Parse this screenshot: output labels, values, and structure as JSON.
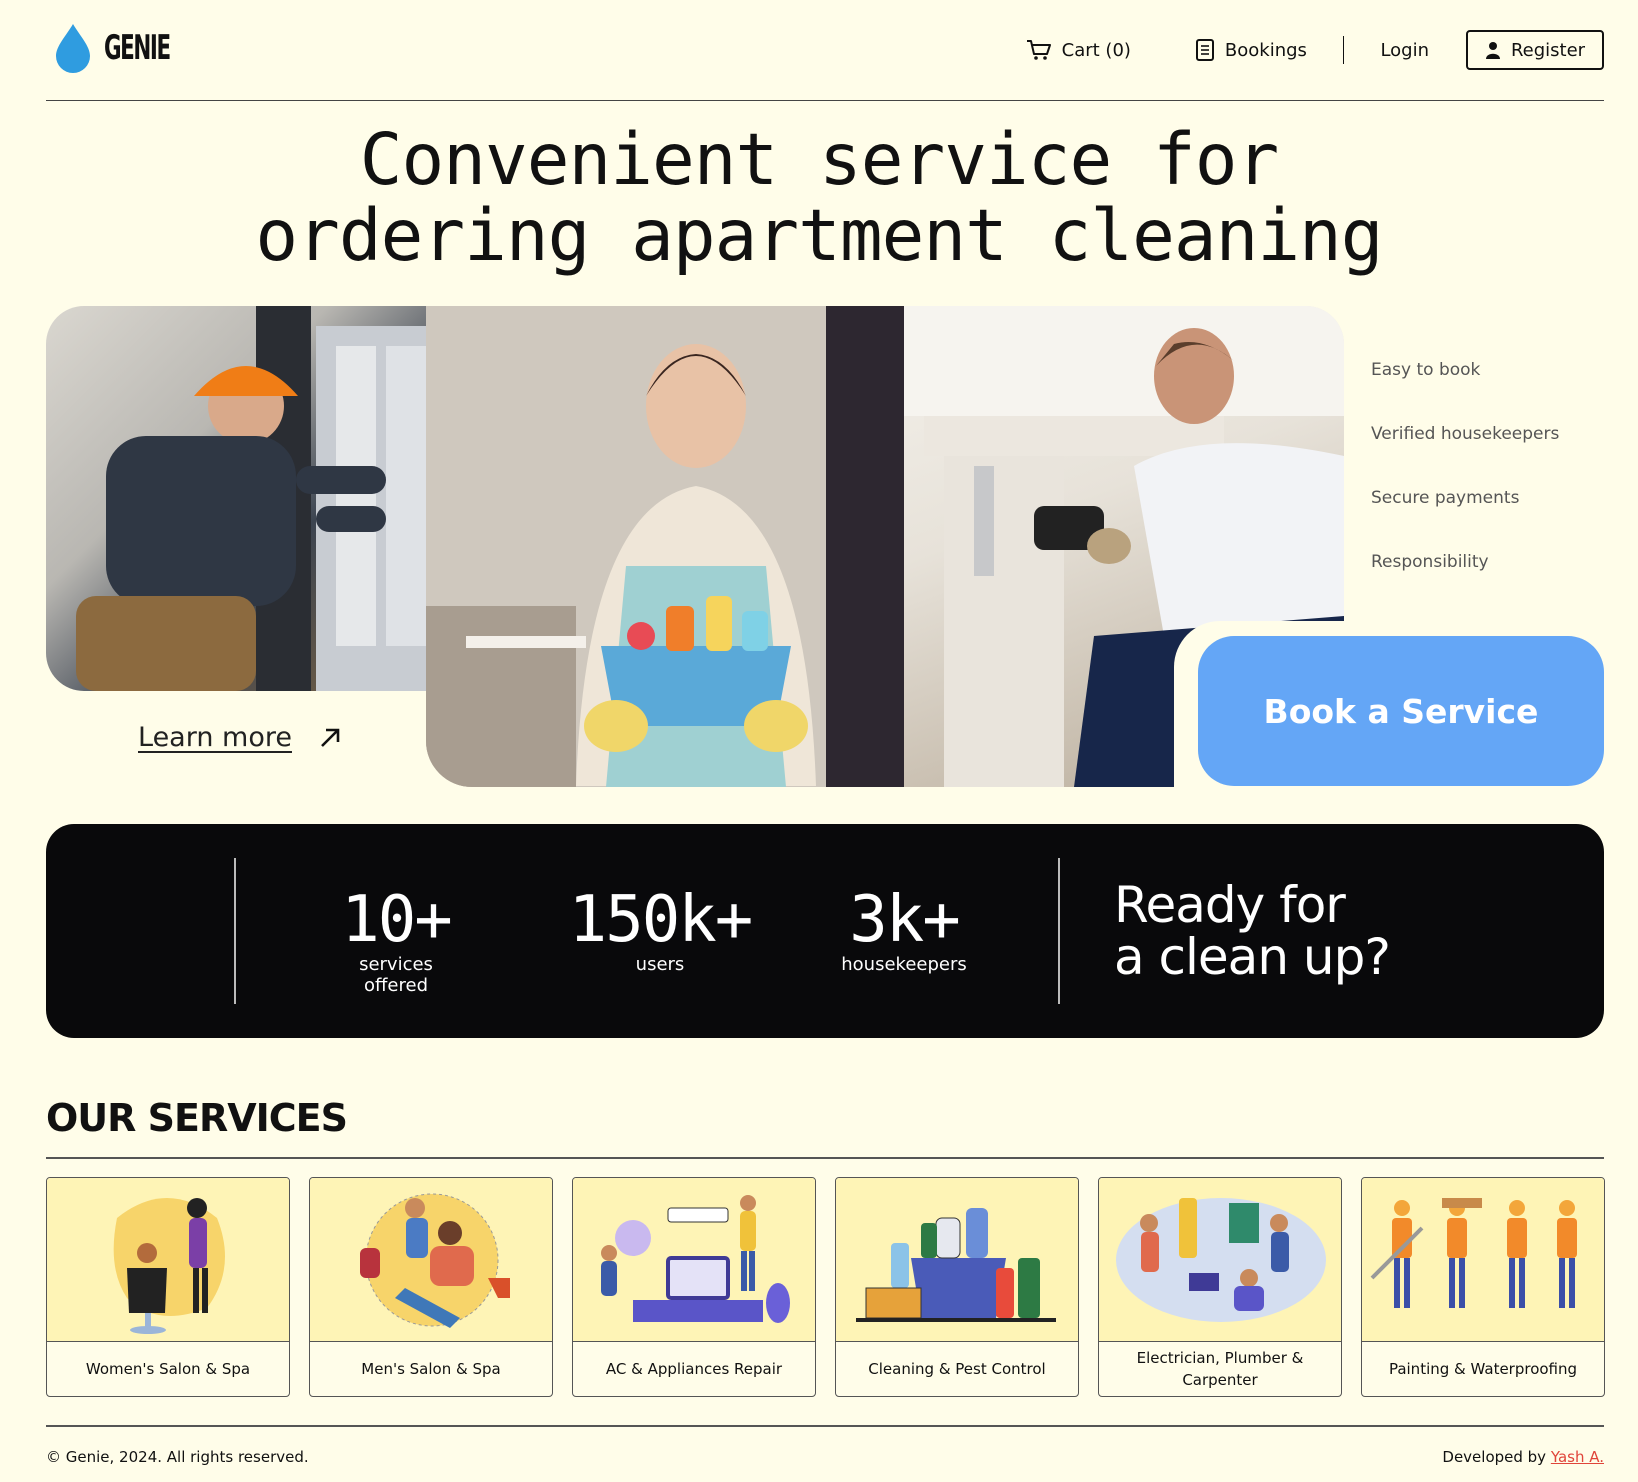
{
  "header": {
    "logo_text": "GENIE",
    "cart_label": "Cart (0)",
    "bookings_label": "Bookings",
    "login_label": "Login",
    "register_label": "Register"
  },
  "hero": {
    "title_line1": "Convenient service for",
    "title_line2": "ordering apartment cleaning",
    "learn_more": "Learn more",
    "book_label": "Book a Service",
    "features": [
      "Easy to book",
      "Verified housekeepers",
      "Secure payments",
      "Responsibility"
    ]
  },
  "stats": {
    "items": [
      {
        "value": "10+",
        "label": "services offered"
      },
      {
        "value": "150k+",
        "label": "users"
      },
      {
        "value": "3k+",
        "label": "housekeepers"
      }
    ],
    "ready_line1": "Ready for",
    "ready_line2": "a clean up?"
  },
  "services": {
    "title": "OUR SERVICES",
    "items": [
      {
        "label": "Women's Salon & Spa"
      },
      {
        "label": "Men's Salon & Spa"
      },
      {
        "label": "AC & Appliances Repair"
      },
      {
        "label": "Cleaning & Pest Control"
      },
      {
        "label": "Electrician, Plumber & Carpenter"
      },
      {
        "label": "Painting & Waterproofing"
      }
    ]
  },
  "footer": {
    "copyright": "© Genie, 2024. All rights reserved.",
    "developed_by": "Developed by",
    "developer": "Yash A."
  },
  "colors": {
    "background": "#fffde9",
    "accent_blue": "#64a6f6",
    "logo_blue": "#2f9ce0",
    "stats_bg": "#09090b",
    "service_img_bg": "#fef4b6",
    "link_red": "#e0453a"
  }
}
